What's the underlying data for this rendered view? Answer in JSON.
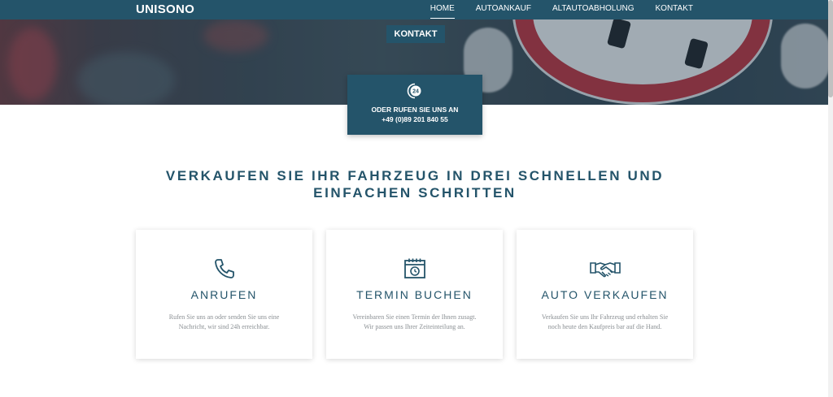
{
  "header": {
    "logo": "UNISONO",
    "nav": [
      {
        "label": "HOME"
      },
      {
        "label": "AUTOANKAUF"
      },
      {
        "label": "ALTAUTOABHOLUNG"
      },
      {
        "label": "KONTAKT"
      }
    ]
  },
  "hero": {
    "label": "KONTAKT"
  },
  "call_box": {
    "icon": "phone-24h-icon",
    "line1": "ODER RUFEN SIE UNS AN",
    "line2": "+49 (0)89 201 840 55"
  },
  "headline": "VERKAUFEN SIE IHR FAHRZEUG IN DREI SCHNELLEN UND EINFACHEN SCHRITTEN",
  "cards": [
    {
      "icon": "phone-icon",
      "title": "ANRUFEN",
      "text": "Rufen Sie uns an oder senden Sie uns eine Nachricht, wir sind 24h erreichbar."
    },
    {
      "icon": "calendar-icon",
      "title": "TERMIN BUCHEN",
      "text": "Vereinbaren Sie einen Termin der Ihnen zusagt. Wir passen uns Ihrer Zeiteinteilung an."
    },
    {
      "icon": "handshake-icon",
      "title": "AUTO VERKAUFEN",
      "text": "Verkaufen Sie uns Ihr Fahrzeug und erhalten Sie noch heute den Kaufpreis bar auf die Hand."
    }
  ],
  "colors": {
    "primary": "#24546a",
    "text_muted": "#8a8f93",
    "background": "#ffffff"
  }
}
